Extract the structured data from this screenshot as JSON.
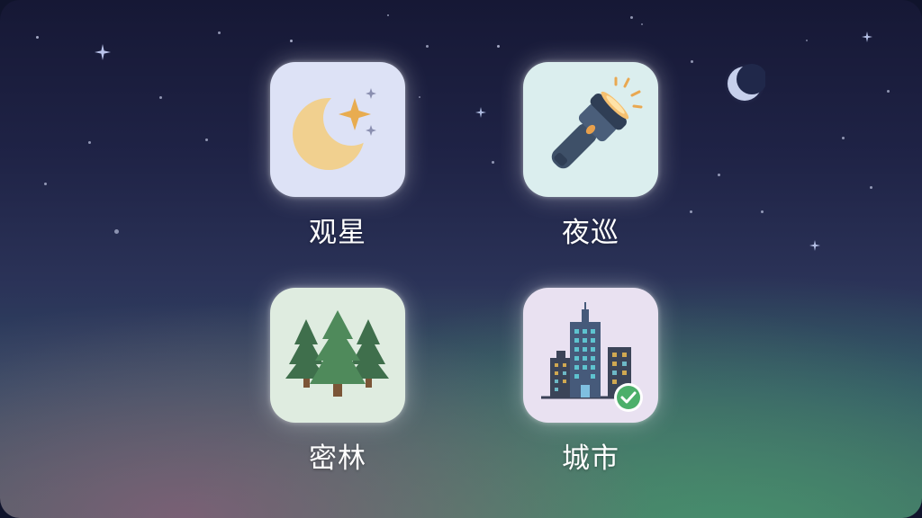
{
  "apps": [
    {
      "id": "stargazing",
      "label": "观星",
      "icon": "moon-star-icon",
      "selected": false
    },
    {
      "id": "night",
      "label": "夜巡",
      "icon": "flashlight-icon",
      "selected": false
    },
    {
      "id": "forest",
      "label": "密林",
      "icon": "pine-trees-icon",
      "selected": false
    },
    {
      "id": "city",
      "label": "城市",
      "icon": "city-buildings-icon",
      "selected": true
    }
  ],
  "colors": {
    "stargazing_tile": "#dde2f6",
    "night_tile": "#dbeeee",
    "forest_tile": "#dfece0",
    "city_tile": "#e9e1f1",
    "selected_check": "#4caf6a"
  }
}
